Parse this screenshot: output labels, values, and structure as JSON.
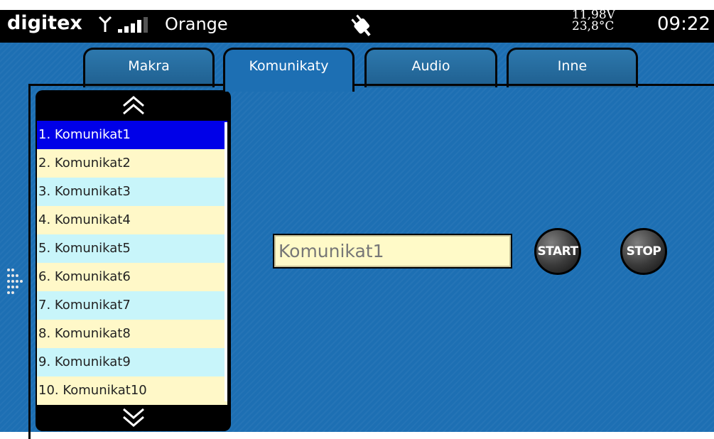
{
  "status_bar": {
    "brand": "digitex",
    "operator": "Orange",
    "voltage": "11,98V",
    "temperature": "23,8°C",
    "clock": "09:22",
    "icons": [
      "antenna-icon",
      "signal-bars-icon",
      "plug-icon"
    ]
  },
  "tabs": [
    {
      "label": "Makra",
      "active": false
    },
    {
      "label": "Komunikaty",
      "active": true
    },
    {
      "label": "Audio",
      "active": false
    },
    {
      "label": "Inne",
      "active": false
    }
  ],
  "messages": {
    "items": [
      "1. Komunikat1",
      "2. Komunikat2",
      "3. Komunikat3",
      "4. Komunikat4",
      "5. Komunikat5",
      "6. Komunikat6",
      "7. Komunikat7",
      "8. Komunikat8",
      "9. Komunikat9",
      "10. Komunikat10"
    ],
    "selected_index": 0
  },
  "message_field": {
    "value": "Komunikat1"
  },
  "buttons": {
    "start": "START",
    "stop": "STOP"
  },
  "colors": {
    "background": "#1d6fb3",
    "selected_row": "#0000e8",
    "row_yellow": "#fff8c8",
    "row_cyan": "#c8f5fa"
  }
}
